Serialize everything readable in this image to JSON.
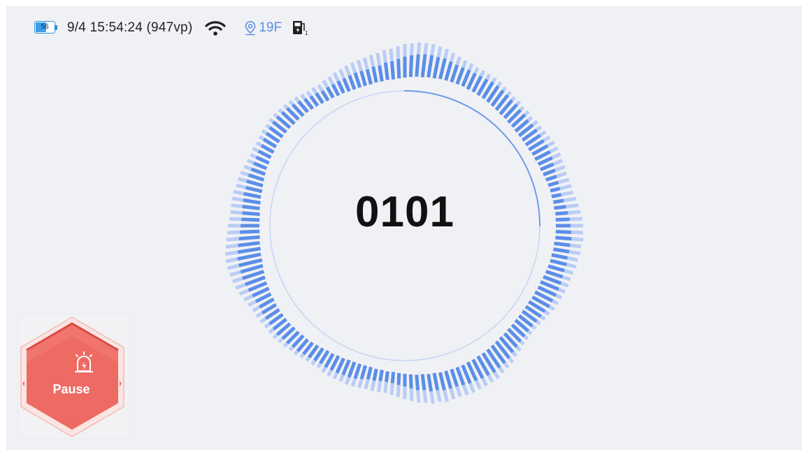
{
  "status_bar": {
    "battery_level": "56",
    "battery_fraction": 0.56,
    "datetime": "9/4 15:54:24 (947vp)",
    "wifi_icon": "wifi-icon",
    "location_icon": "location-pin-icon",
    "floor": "19F",
    "charger_icon": "charging-station-icon",
    "charger_sub": "1"
  },
  "dial": {
    "value": "0101",
    "progress_fraction": 0.25,
    "colors": {
      "accent": "#5b8ee8",
      "accent_light": "#b9cdf5",
      "ring": "#a9c1f2"
    }
  },
  "pause_button": {
    "label": "Pause",
    "icon": "alarm-lightning-icon",
    "color": "#ee6b63"
  }
}
